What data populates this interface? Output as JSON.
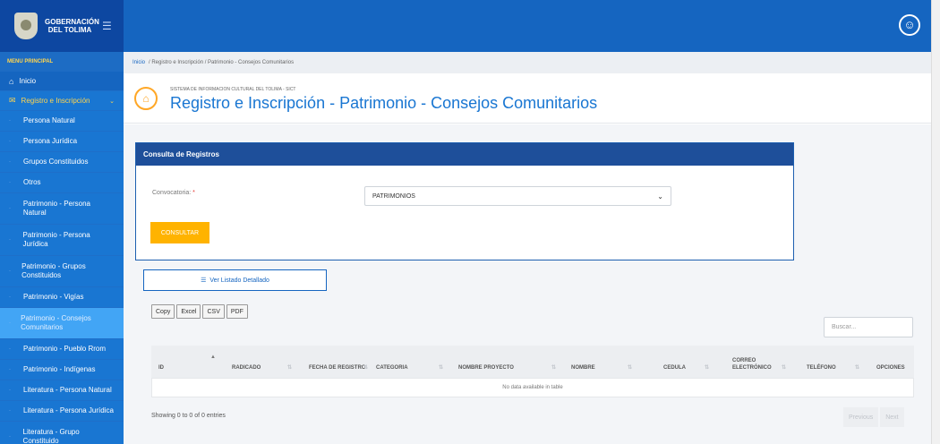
{
  "brand": {
    "name_line1": "GOBERNACIÓN",
    "name_line2": "DEL TOLIMA"
  },
  "sidebar": {
    "title": "MENU PRINCIPAL",
    "inicio": "Inicio",
    "registro": "Registro e Inscripción",
    "items": [
      "Persona Natural",
      "Persona Jurídica",
      "Grupos Constituidos",
      "Otros",
      "Patrimonio - Persona Natural",
      "Patrimonio - Persona Jurídica",
      "Patrimonio - Grupos Constituidos",
      "Patrimonio - Vigías",
      "Patrimonio - Consejos Comunitarios",
      "Patrimonio - Pueblo Rrom",
      "Patrimonio - Indígenas",
      "Literatura - Persona Natural",
      "Literatura - Persona Jurídica",
      "Literatura - Grupo Constituido"
    ]
  },
  "breadcrumb": {
    "home": "Inicio",
    "rest": "/ Registro e Inscripción / Patrimonio - Consejos Comunitarios"
  },
  "header": {
    "system": "SISTEMA DE INFORMACION CULTURAL DEL TOLIMA - SICT",
    "title": "Registro e Inscripción - Patrimonio - Consejos Comunitarios"
  },
  "consulta": {
    "card_title": "Consulta de Registros",
    "label": "Convocatoria:",
    "required": "*",
    "selected": "PATRIMONIOS",
    "button": "CONSULTAR"
  },
  "listado_button": "Ver Listado Detallado",
  "exports": [
    "Copy",
    "Excel",
    "CSV",
    "PDF"
  ],
  "search_placeholder": "Buscar...",
  "table": {
    "columns": [
      "ID",
      "RADICADO",
      "FECHA DE REGISTRO",
      "CATEGORIA",
      "NOMBRE PROYECTO",
      "NOMBRE",
      "CEDULA",
      "CORREO ELECTRÓNICO",
      "TELÉFONO",
      "OPCIONES"
    ],
    "empty": "No data available in table"
  },
  "info": "Showing 0 to 0 of 0 entries",
  "pager": {
    "previous": "Previous",
    "next": "Next"
  },
  "colors": {
    "primary": "#1565c0",
    "accent": "#ffb300",
    "card_header": "#1e4f9a"
  }
}
